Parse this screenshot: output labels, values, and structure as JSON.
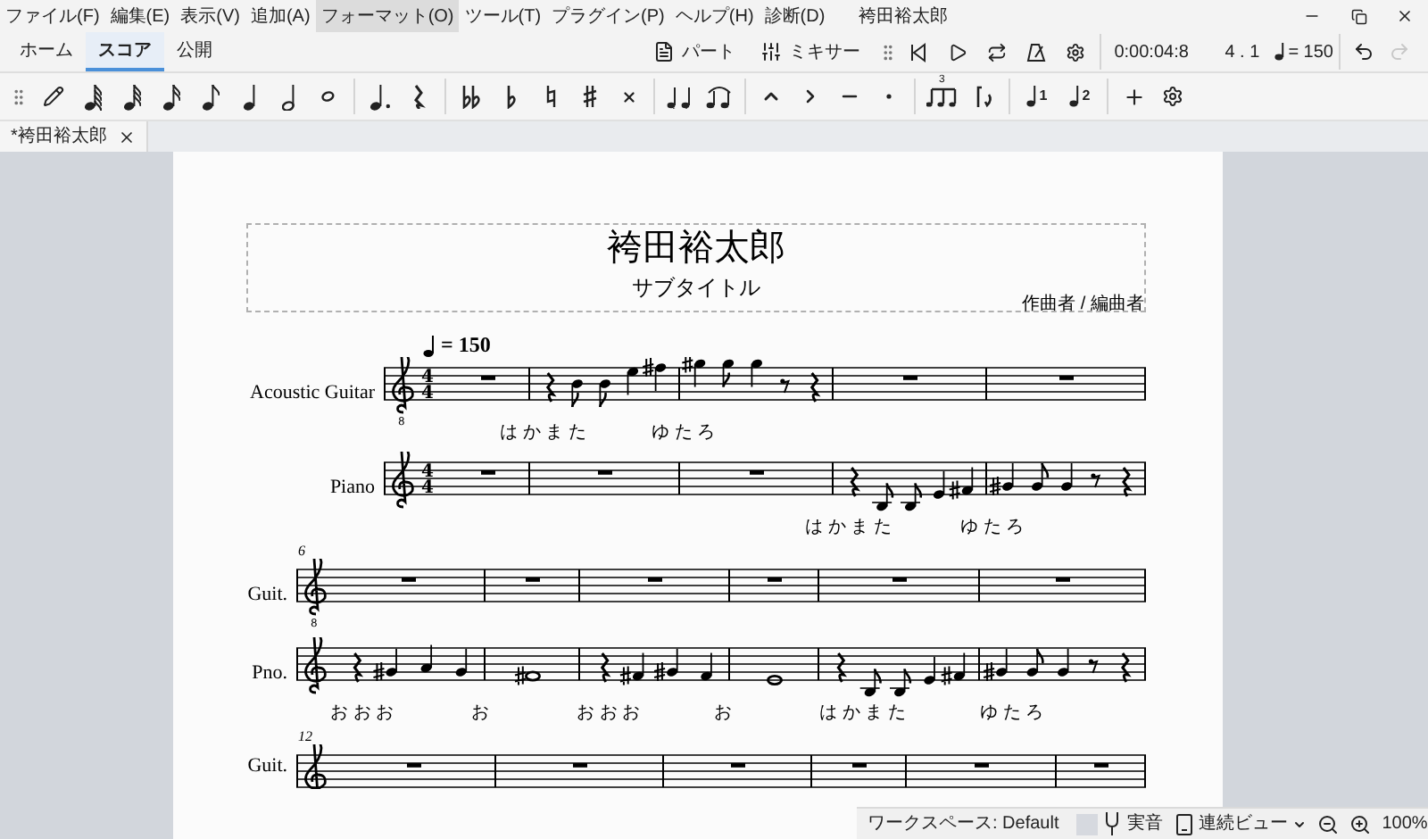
{
  "menu_bar": {
    "items": [
      {
        "label": "ファイル(F)",
        "highlighted": false
      },
      {
        "label": "編集(E)",
        "highlighted": false
      },
      {
        "label": "表示(V)",
        "highlighted": false
      },
      {
        "label": "追加(A)",
        "highlighted": false
      },
      {
        "label": "フォーマット(O)",
        "highlighted": true
      },
      {
        "label": "ツール(T)",
        "highlighted": false
      },
      {
        "label": "プラグイン(P)",
        "highlighted": false
      },
      {
        "label": "ヘルプ(H)",
        "highlighted": false
      },
      {
        "label": "診断(D)",
        "highlighted": false
      }
    ],
    "title": "袴田裕太郎"
  },
  "tabs": [
    {
      "label": "ホーム",
      "selected": false
    },
    {
      "label": "スコア",
      "selected": true
    },
    {
      "label": "公開",
      "selected": false
    }
  ],
  "panels": [
    {
      "kind": "parts",
      "label": "パート"
    },
    {
      "kind": "mixer",
      "label": "ミキサー"
    }
  ],
  "playback": {
    "time": "0:00:04:8",
    "position": "4 . 1",
    "tempo": "= 150"
  },
  "history": {
    "undo": {
      "disabled": false
    },
    "redo": {
      "disabled": true
    }
  },
  "toolbar": {
    "tuplet": "3",
    "voices": [
      "1",
      "2"
    ]
  },
  "document_tab": {
    "label": "*袴田裕太郎"
  },
  "score": {
    "title": "袴田裕太郎",
    "subtitle": "サブタイトル",
    "composer": "作曲者 / 編曲者",
    "tempo": "= 150",
    "systems": [
      {
        "staves": [
          {
            "label": "Acoustic Guitar",
            "clef_mark": "8",
            "time_signature": [
              "4",
              "4"
            ],
            "lyrics": [
              "は か ま た",
              "ゆ た ろ"
            ]
          },
          {
            "label": "Piano",
            "time_signature": [
              "4",
              "4"
            ],
            "lyrics": [
              "は か ま た",
              "ゆ た ろ"
            ]
          }
        ]
      },
      {
        "measure_number": "6",
        "staves": [
          {
            "label": "Guit.",
            "clef_mark": "8"
          },
          {
            "label": "Pno.",
            "lyrics": [
              "お お お",
              "お",
              "お お お",
              "お",
              "は か ま た",
              "ゆ た ろ"
            ]
          }
        ]
      },
      {
        "measure_number": "12",
        "staves": [
          {
            "label": "Guit."
          }
        ]
      }
    ]
  },
  "status_bar": {
    "workspace": "ワークスペース: Default",
    "concert_pitch": "実音",
    "view_mode": "連続ビュー",
    "zoom": "100%"
  }
}
